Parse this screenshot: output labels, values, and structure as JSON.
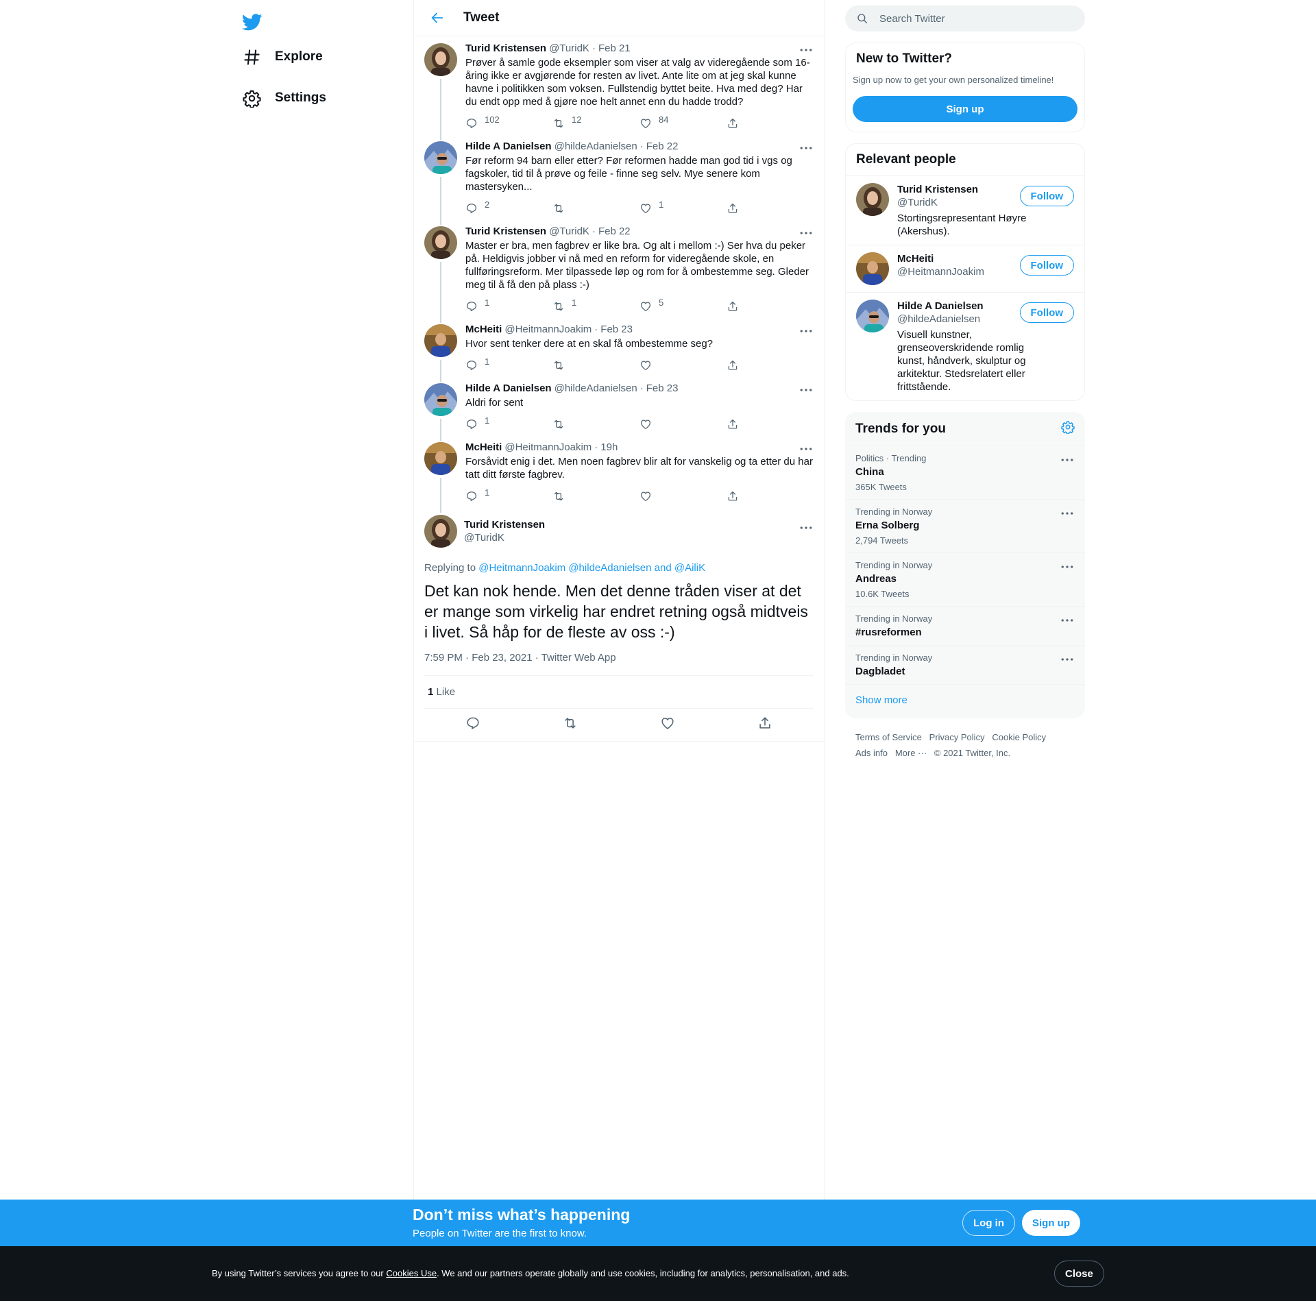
{
  "nav": {
    "logo": "twitter-bird-icon",
    "explore_label": "Explore",
    "settings_label": "Settings"
  },
  "header": {
    "title": "Tweet"
  },
  "thread": [
    {
      "name": "Turid Kristensen",
      "handle": "@TuridK",
      "date": "Feb 21",
      "avatar": "turid",
      "text": "Prøver å samle gode eksempler som viser at valg av videregående som 16-åring ikke er avgjørende for resten av livet. Ante lite om at jeg skal kunne havne i politikken som voksen. Fullstendig byttet beite. Hva med deg? Har du endt opp med å gjøre noe helt annet enn du hadde trodd?",
      "replies": "102",
      "retweets": "12",
      "likes": "84"
    },
    {
      "name": "Hilde A Danielsen",
      "handle": "@hildeAdanielsen",
      "date": "Feb 22",
      "avatar": "hilde",
      "text": "Før reform 94 barn eller etter? Før reformen hadde man god tid i vgs og fagskoler, tid til å prøve og feile - finne seg selv. Mye senere kom mastersyken...",
      "replies": "2",
      "retweets": "",
      "likes": "1"
    },
    {
      "name": "Turid Kristensen",
      "handle": "@TuridK",
      "date": "Feb 22",
      "avatar": "turid",
      "text": "Master er bra, men fagbrev er like bra. Og alt i mellom :-) Ser hva du peker på. Heldigvis jobber vi nå med en reform for videregående skole, en fullføringsreform. Mer tilpassede løp og rom for å ombestemme seg. Gleder meg til å få den på plass :-)",
      "replies": "1",
      "retweets": "1",
      "likes": "5"
    },
    {
      "name": "McHeiti",
      "handle": "@HeitmannJoakim",
      "date": "Feb 23",
      "avatar": "mcheiti",
      "text": "Hvor sent tenker dere at en skal få ombestemme seg?",
      "replies": "1",
      "retweets": "",
      "likes": ""
    },
    {
      "name": "Hilde A Danielsen",
      "handle": "@hildeAdanielsen",
      "date": "Feb 23",
      "avatar": "hilde",
      "text": "Aldri for sent",
      "replies": "1",
      "retweets": "",
      "likes": ""
    },
    {
      "name": "McHeiti",
      "handle": "@HeitmannJoakim",
      "date": "19h",
      "avatar": "mcheiti",
      "text": "Forsåvidt enig i det. Men noen fagbrev blir alt for vanskelig og ta etter du har tatt ditt første fagbrev.",
      "replies": "1",
      "retweets": "",
      "likes": ""
    }
  ],
  "focus": {
    "name": "Turid Kristensen",
    "handle": "@TuridK",
    "replying_prefix": "Replying to ",
    "replying_1": "@HeitmannJoakim",
    "replying_2": "@hildeAdanielsen",
    "replying_and": " and ",
    "replying_3": "@AiliK",
    "text": "Det kan nok hende. Men det denne tråden viser at det er mange som virkelig har endret retning også midtveis i livet. Så håp for de fleste av oss :-)",
    "time": "7:59 PM · Feb 23, 2021 · Twitter Web App",
    "like_count": "1",
    "like_label": "Like"
  },
  "search": {
    "placeholder": "Search Twitter"
  },
  "new_to_twitter": {
    "title": "New to Twitter?",
    "subtitle": "Sign up now to get your own personalized timeline!",
    "signup_label": "Sign up"
  },
  "relevant": {
    "title": "Relevant people",
    "follow_label": "Follow",
    "people": [
      {
        "name": "Turid Kristensen",
        "handle": "@TuridK",
        "bio": "Stortingsrepresentant Høyre (Akershus).",
        "avatar": "turid"
      },
      {
        "name": "McHeiti",
        "handle": "@HeitmannJoakim",
        "bio": "",
        "avatar": "mcheiti"
      },
      {
        "name": "Hilde A Danielsen",
        "handle": "@hildeAdanielsen",
        "bio": "Visuell kunstner, grenseoverskridende romlig kunst, håndverk, skulptur og arkitektur. Stedsrelatert eller frittstående.",
        "avatar": "hilde"
      }
    ]
  },
  "trends": {
    "title": "Trends for you",
    "items": [
      {
        "context": "Politics · Trending",
        "name": "China",
        "count": "365K Tweets"
      },
      {
        "context": "Trending in Norway",
        "name": "Erna Solberg",
        "count": "2,794 Tweets"
      },
      {
        "context": "Trending in Norway",
        "name": "Andreas",
        "count": "10.6K Tweets"
      },
      {
        "context": "Trending in Norway",
        "name": "#rusreformen",
        "count": ""
      },
      {
        "context": "Trending in Norway",
        "name": "Dagbladet",
        "count": ""
      }
    ],
    "show_more": "Show more"
  },
  "footer": {
    "terms": "Terms of Service",
    "privacy": "Privacy Policy",
    "cookie": "Cookie Policy",
    "ads": "Ads info",
    "more": "More ···",
    "copyright": "© 2021 Twitter, Inc."
  },
  "bottom_bar": {
    "title": "Don’t miss what’s happening",
    "subtitle": "People on Twitter are the first to know.",
    "login_label": "Log in",
    "signup_label": "Sign up"
  },
  "cookie_bar": {
    "text_before": "By using Twitter’s services you agree to our ",
    "link": "Cookies Use",
    "text_after": ". We and our partners operate globally and use cookies, including for analytics, personalisation, and ads.",
    "close_label": "Close"
  },
  "colors": {
    "accent": "#1d9bf0",
    "text": "#0f1419",
    "secondary": "#536471",
    "cookie_bg": "#0f1419"
  }
}
